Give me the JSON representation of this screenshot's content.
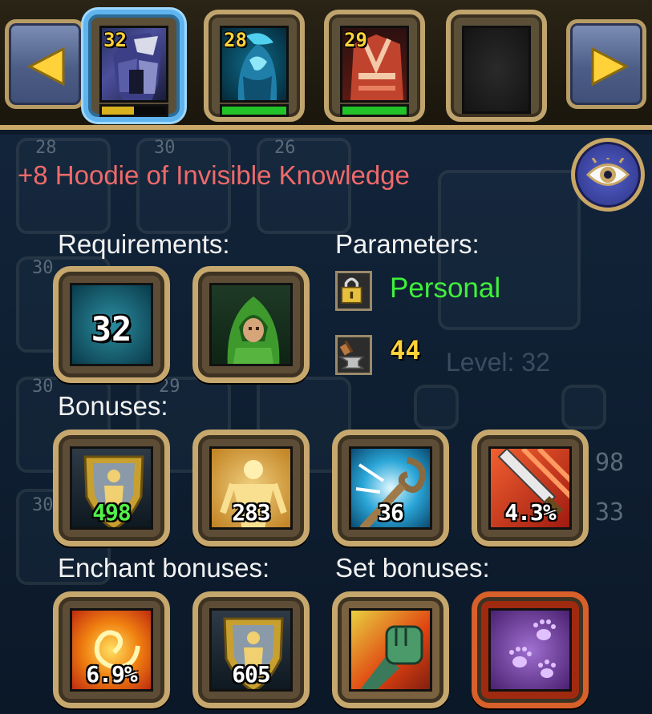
{
  "carousel": {
    "characters": [
      {
        "level": "32",
        "bar_fraction": 0.5,
        "bar_color": "#d8b21e",
        "selected": true
      },
      {
        "level": "28",
        "bar_fraction": 1.0,
        "bar_color": "#22c328",
        "selected": false
      },
      {
        "level": "29",
        "bar_fraction": 1.0,
        "bar_color": "#22c328",
        "selected": false
      },
      {
        "level": "",
        "bar_fraction": 0,
        "bar_color": "#22c328",
        "selected": false
      }
    ],
    "left_arrow_icon": "arrow-left-icon",
    "right_arrow_icon": "arrow-right-icon"
  },
  "background": {
    "ghost_levels": [
      "28",
      "30",
      "26",
      "30",
      "30",
      "29",
      "30"
    ],
    "ghost_numbers": [
      "98",
      "33"
    ],
    "level_text": "Level: 32"
  },
  "item": {
    "title": "+8 Hoodie of Invisible Knowledge",
    "view_icon": "eye-icon"
  },
  "requirements": {
    "label": "Requirements:",
    "level": "32",
    "class_icon": "hooded-ranger-icon"
  },
  "parameters": {
    "label": "Parameters:",
    "binding_icon": "padlock-icon",
    "binding_text": "Personal",
    "durability_icon": "anvil-icon",
    "durability_value": "44"
  },
  "bonuses": {
    "label": "Bonuses:",
    "items": [
      {
        "icon": "armor-shield-icon",
        "value": "498",
        "green": true
      },
      {
        "icon": "stamina-figure-icon",
        "value": "283",
        "green": false
      },
      {
        "icon": "magic-staff-icon",
        "value": "36",
        "green": false
      },
      {
        "icon": "sword-crit-icon",
        "value": "4.3%",
        "green": false
      }
    ]
  },
  "enchant_bonuses": {
    "label": "Enchant bonuses:",
    "items": [
      {
        "icon": "fire-swirl-icon",
        "value": "6.9%"
      },
      {
        "icon": "armor-shield-icon",
        "value": "605"
      }
    ]
  },
  "set_bonuses": {
    "label": "Set bonuses:",
    "items": [
      {
        "icon": "fist-icon"
      },
      {
        "icon": "paw-prints-icon"
      }
    ]
  },
  "colors": {
    "title": "#ef6a6a",
    "personal": "#3ff03b",
    "gold_value": "#ffd23a",
    "frame": "#c6a86e"
  }
}
